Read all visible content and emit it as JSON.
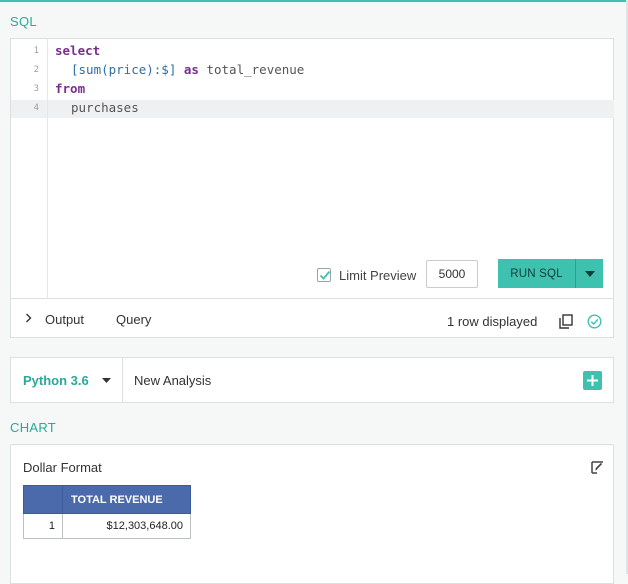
{
  "sql_section": {
    "label": "SQL",
    "lines": [
      {
        "num": "1"
      },
      {
        "num": "2"
      },
      {
        "num": "3"
      },
      {
        "num": "4"
      }
    ],
    "code": {
      "l1_kw": "select",
      "l2_expr": "[sum(price):$]",
      "l2_kw": "as",
      "l2_alias": "total_revenue",
      "l3_kw": "from",
      "l4_table": "purchases"
    },
    "limit_preview_label": "Limit Preview",
    "limit_preview_checked": true,
    "limit_value": "5000",
    "run_button_label": "RUN SQL"
  },
  "results_tabs": {
    "output_label": "Output",
    "query_label": "Query",
    "rows_displayed": "1 row displayed"
  },
  "analysis_bar": {
    "language": "Python 3.6",
    "title": "New Analysis"
  },
  "chart_section": {
    "label": "CHART",
    "chart_name": "Dollar Format",
    "table": {
      "header": "TOTAL REVENUE",
      "rows": [
        {
          "index": "1",
          "value": "$12,303,648.00"
        }
      ]
    }
  },
  "colors": {
    "accent": "#3fc1b0",
    "accent_text": "#2aa89a",
    "table_header": "#4a6aab",
    "keyword": "#7a2e8e"
  },
  "icons": [
    "chevron-right-icon",
    "copy-icon",
    "check-circle-icon",
    "caret-down-icon",
    "plus-icon",
    "edit-chart-icon",
    "checkmark-icon"
  ]
}
